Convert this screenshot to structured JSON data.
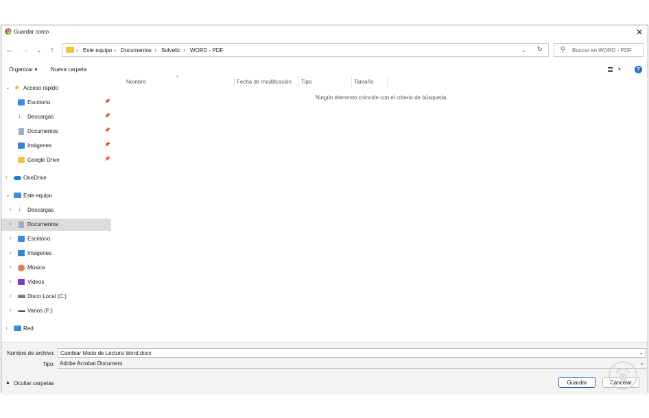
{
  "window": {
    "title": "Guardar como",
    "close_label": "✕"
  },
  "nav_buttons": {
    "back": "←",
    "forward": "→",
    "recent": "⌄",
    "up": "↑"
  },
  "breadcrumb": [
    "Este equipo",
    "Documentos",
    "Solvetic",
    "WORD - PDF"
  ],
  "search": {
    "placeholder": "Buscar en WORD - PDF"
  },
  "toolbar": {
    "organize": "Organizar ▾",
    "new_folder": "Nueva carpeta",
    "help": "?"
  },
  "sidebar": {
    "quick_access": {
      "label": "Acceso rápido",
      "items": [
        "Escritorio",
        "Descargas",
        "Documentos",
        "Imágenes",
        "Google Drive"
      ]
    },
    "onedrive": "OneDrive",
    "this_pc": {
      "label": "Este equipo",
      "items": [
        "Descargas",
        "Documentos",
        "Escritorio",
        "Imágenes",
        "Música",
        "Videos",
        "Disco Local (C:)",
        "Varios (F:)"
      ]
    },
    "network": "Red",
    "selected": "Documentos"
  },
  "columns": [
    "Nombre",
    "Fecha de modificación",
    "Tipo",
    "Tamaño"
  ],
  "empty_message": "Ningún elemento coincide con el criterio de búsqueda.",
  "form": {
    "filename_label": "Nombre de archivo:",
    "filename_value": "Cambiar Modo de Lectura Word.docx",
    "type_label": "Tipo:",
    "type_value": "Adobe Acrobat Document",
    "hide_folders": "Ocultar carpetas",
    "save_button": "Guardar",
    "cancel_button": "Cancelar"
  },
  "colors": {
    "accent": "#0f6cbd",
    "folder": "#f5c342",
    "selection": "#dcdcdc"
  }
}
